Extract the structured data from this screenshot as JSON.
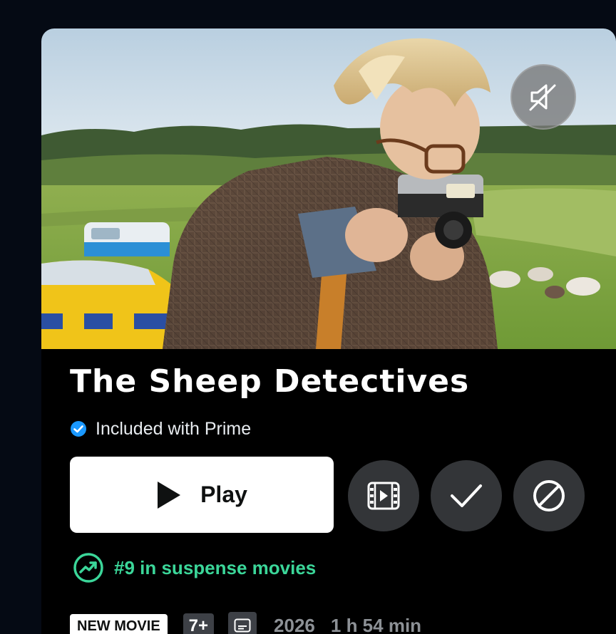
{
  "title": "The Sheep Detectives",
  "availability": {
    "label": "Included with Prime",
    "icon": "checkmark-badge-icon",
    "color": "#1a98ff"
  },
  "actions": {
    "play_label": "Play",
    "play_icon": "play-icon",
    "trailer_icon": "trailer-icon",
    "watchlist_icon": "checkmark-icon",
    "hide_icon": "prohibited-icon",
    "mute_icon": "muted-speaker-icon"
  },
  "ranking": {
    "label": "#9 in suspense movies",
    "icon": "trending-up-icon",
    "color": "#3bd699"
  },
  "meta": {
    "badge": "NEW MOVIE",
    "age_rating": "7+",
    "subtitles_icon": "subtitles-icon",
    "year": "2026",
    "runtime": "1 h 54 min"
  },
  "colors": {
    "background": "#050a14",
    "card": "#000000",
    "accent_green": "#3bd699",
    "button_dark": "#333538"
  }
}
